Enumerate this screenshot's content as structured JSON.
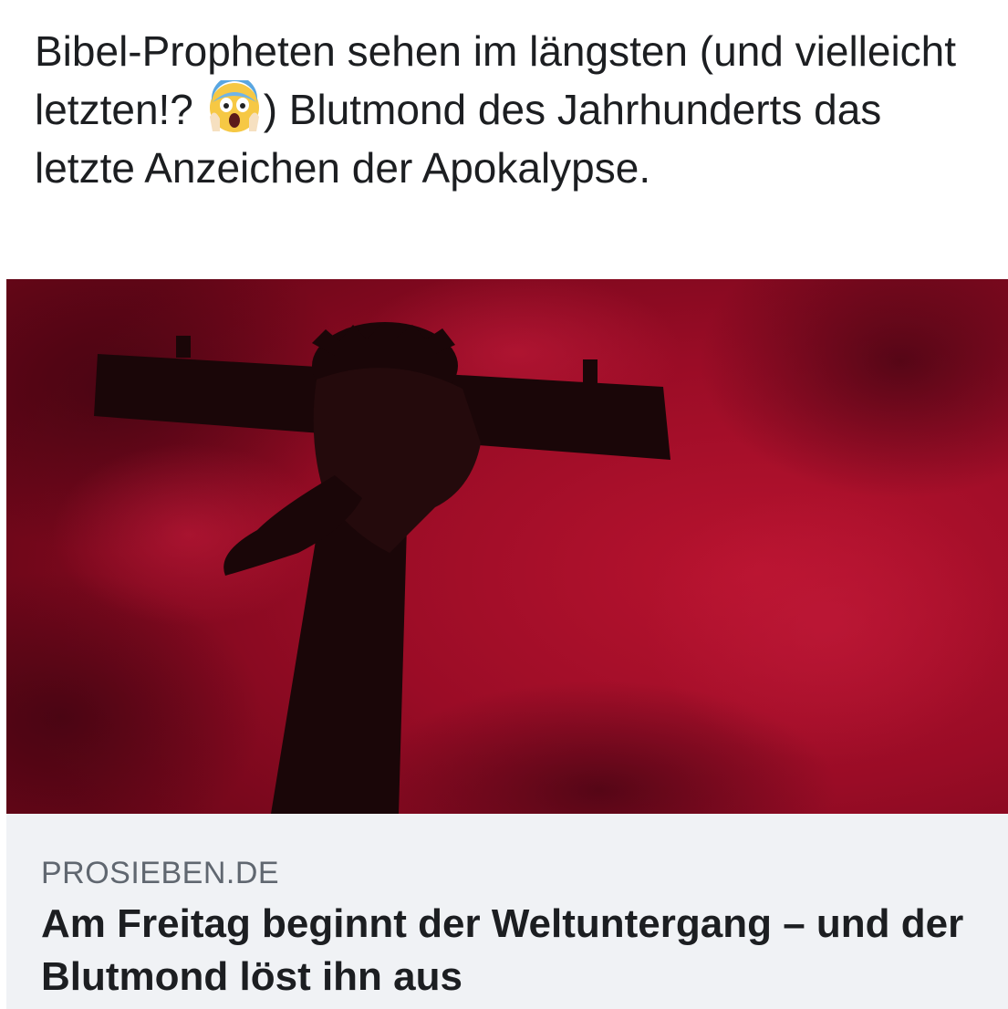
{
  "post": {
    "text_part1": "Bibel-Propheten sehen im längsten (und vielleicht letzten!?",
    "emoji_icon": "face-screaming-in-fear-icon",
    "text_part2": ") Blutmond des Jahrhunderts das letzte Anzeichen der Apokalypse."
  },
  "link_card": {
    "domain": "PROSIEBEN.DE",
    "title": "Am Freitag beginnt der Weltuntergang – und der Blutmond löst ihn aus",
    "image_subject": "crucifix-silhouette-red-sky-image"
  },
  "colors": {
    "sky": "#a0102a",
    "silhouette": "#1a0608",
    "footer_bg": "#f0f2f5",
    "domain_text": "#606770",
    "title_text": "#1c1e21"
  }
}
